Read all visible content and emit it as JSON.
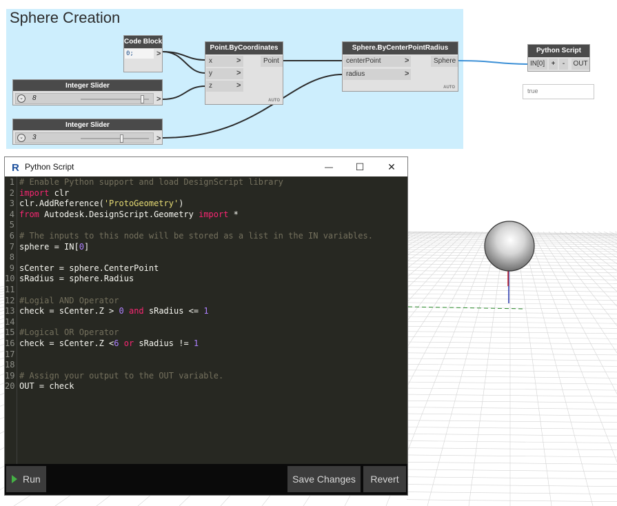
{
  "group": {
    "title": "Sphere Creation"
  },
  "nodes": {
    "code_block": {
      "title": "Code Block",
      "value": "0;",
      "out": ">"
    },
    "slider1": {
      "title": "Integer Slider",
      "value": "8",
      "level": 0.9
    },
    "slider2": {
      "title": "Integer Slider",
      "value": "3",
      "level": 0.6
    },
    "point": {
      "title": "Point.ByCoordinates",
      "inputs": [
        "x",
        "y",
        "z"
      ],
      "output": "Point",
      "lacing": "AUTO"
    },
    "sphere": {
      "title": "Sphere.ByCenterPointRadius",
      "inputs": [
        "centerPoint",
        "radius"
      ],
      "output": "Sphere",
      "lacing": "AUTO"
    },
    "python": {
      "title": "Python Script",
      "input": "IN[0]",
      "add": "+",
      "remove": "-",
      "output": "OUT"
    },
    "watch": {
      "value": "true"
    }
  },
  "editor": {
    "title": "Python Script",
    "controls": {
      "minimize": "—",
      "maximize": "☐",
      "close": "✕"
    },
    "lines": [
      [
        {
          "t": "comment",
          "v": "# Enable Python support and load DesignScript library"
        }
      ],
      [
        {
          "t": "keyword",
          "v": "import"
        },
        {
          "t": "plain",
          "v": " clr"
        }
      ],
      [
        {
          "t": "plain",
          "v": "clr.AddReference("
        },
        {
          "t": "string",
          "v": "'ProtoGeometry'"
        },
        {
          "t": "plain",
          "v": ")"
        }
      ],
      [
        {
          "t": "keyword",
          "v": "from"
        },
        {
          "t": "plain",
          "v": " Autodesk.DesignScript.Geometry "
        },
        {
          "t": "keyword",
          "v": "import"
        },
        {
          "t": "plain",
          "v": " *"
        }
      ],
      [],
      [
        {
          "t": "comment",
          "v": "# The inputs to this node will be stored as a list in the IN variables."
        }
      ],
      [
        {
          "t": "plain",
          "v": "sphere = IN["
        },
        {
          "t": "number",
          "v": "0"
        },
        {
          "t": "plain",
          "v": "]"
        }
      ],
      [],
      [
        {
          "t": "plain",
          "v": "sCenter = sphere.CenterPoint"
        }
      ],
      [
        {
          "t": "plain",
          "v": "sRadius = sphere.Radius"
        }
      ],
      [],
      [
        {
          "t": "comment",
          "v": "#Logial AND Operator"
        }
      ],
      [
        {
          "t": "plain",
          "v": "check = sCenter.Z > "
        },
        {
          "t": "number",
          "v": "0"
        },
        {
          "t": "plain",
          "v": " "
        },
        {
          "t": "keyword",
          "v": "and"
        },
        {
          "t": "plain",
          "v": " sRadius <= "
        },
        {
          "t": "number",
          "v": "1"
        }
      ],
      [],
      [
        {
          "t": "comment",
          "v": "#Logical OR Operator"
        }
      ],
      [
        {
          "t": "plain",
          "v": "check = sCenter.Z <"
        },
        {
          "t": "number",
          "v": "6"
        },
        {
          "t": "plain",
          "v": " "
        },
        {
          "t": "keyword",
          "v": "or"
        },
        {
          "t": "plain",
          "v": " sRadius != "
        },
        {
          "t": "number",
          "v": "1"
        }
      ],
      [],
      [],
      [
        {
          "t": "comment",
          "v": "# Assign your output to the OUT variable."
        }
      ],
      [
        {
          "t": "plain",
          "v": "OUT = check"
        }
      ]
    ]
  },
  "buttons": {
    "run": "Run",
    "save": "Save Changes",
    "revert": "Revert"
  },
  "colors": {
    "group_bg": "#cdeefd",
    "wire": "#2c2c2c",
    "active_wire": "#3b8fd6",
    "editor_bg": "#272822"
  }
}
